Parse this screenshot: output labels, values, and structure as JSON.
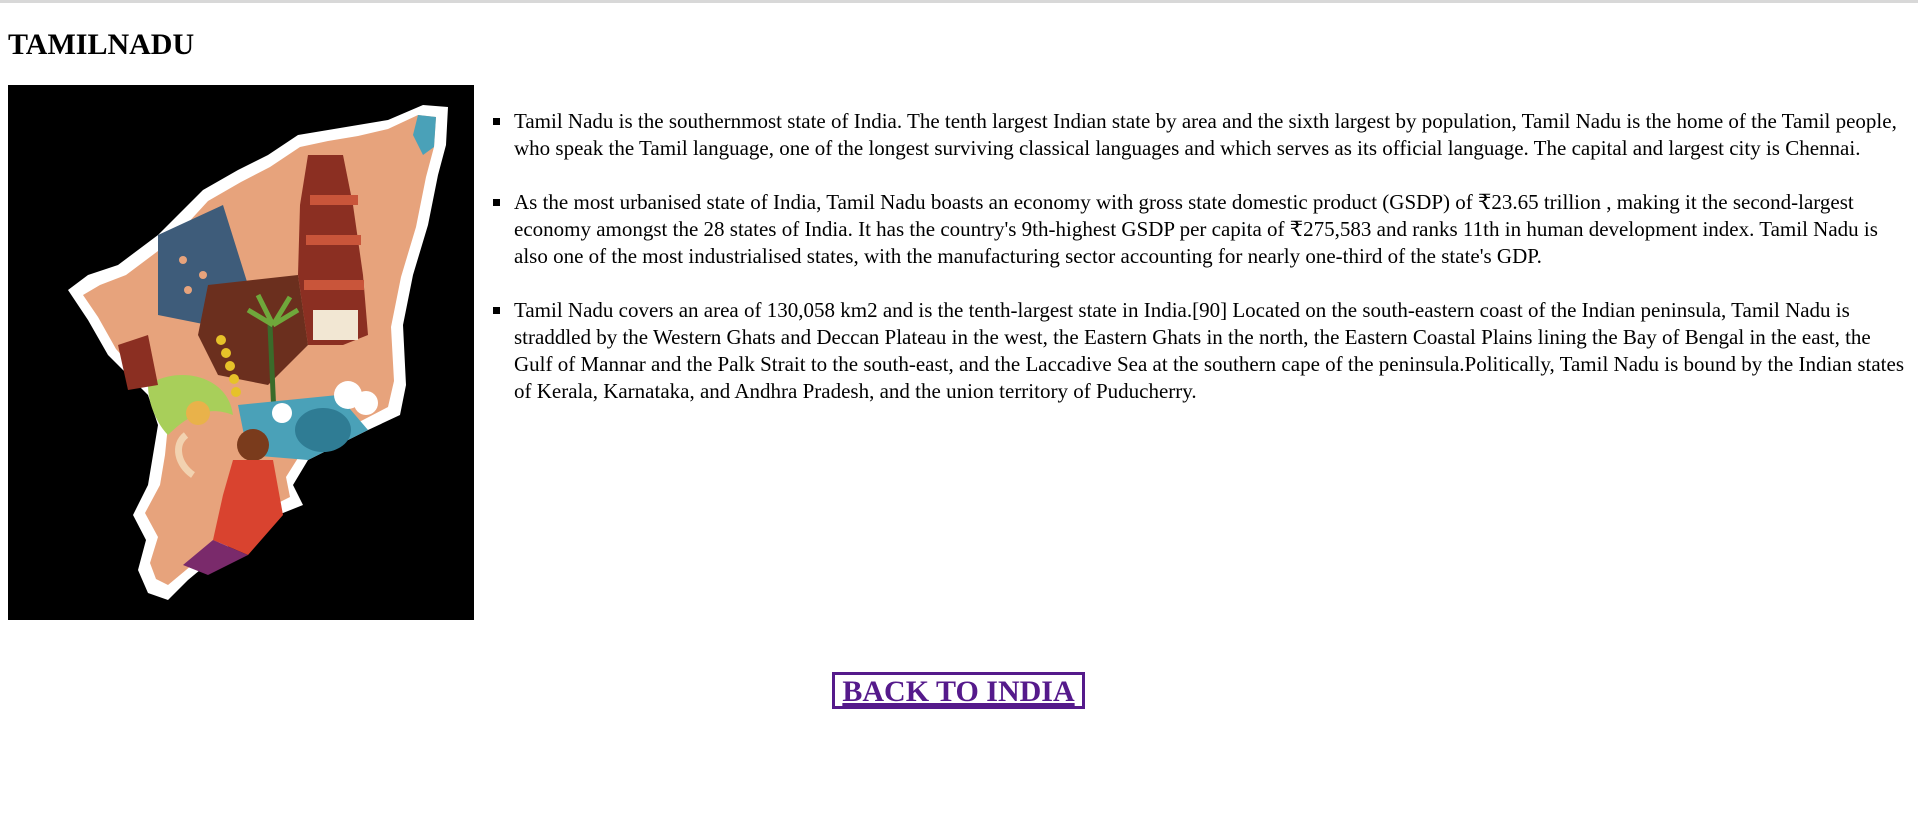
{
  "page": {
    "title": "TAMILNADU"
  },
  "image": {
    "description_icon": "tamil-nadu-illustrated-map-icon",
    "background_color": "#000000"
  },
  "facts": [
    "Tamil Nadu is the southernmost state of India. The tenth largest Indian state by area and the sixth largest by population, Tamil Nadu is the home of the Tamil people, who speak the Tamil language, one of the longest surviving classical languages and which serves as its official language. The capital and largest city is Chennai.",
    "As the most urbanised state of India, Tamil Nadu boasts an economy with gross state domestic product (GSDP) of ₹23.65 trillion , making it the second-largest economy amongst the 28 states of India. It has the country's 9th-highest GSDP per capita of ₹275,583 and ranks 11th in human development index. Tamil Nadu is also one of the most industrialised states, with the manufacturing sector accounting for nearly one-third of the state's GDP.",
    "Tamil Nadu covers an area of 130,058 km2 and is the tenth-largest state in India.[90] Located on the south-eastern coast of the Indian peninsula, Tamil Nadu is straddled by the Western Ghats and Deccan Plateau in the west, the Eastern Ghats in the north, the Eastern Coastal Plains lining the Bay of Bengal in the east, the Gulf of Mannar and the Palk Strait to the south-east, and the Laccadive Sea at the southern cape of the peninsula.Politically, Tamil Nadu is bound by the Indian states of Kerala, Karnataka, and Andhra Pradesh, and the union territory of Puducherry."
  ],
  "nav": {
    "back_label": "BACK TO INDIA"
  },
  "colors": {
    "link": "#551a8b",
    "text": "#000000",
    "background": "#ffffff"
  }
}
